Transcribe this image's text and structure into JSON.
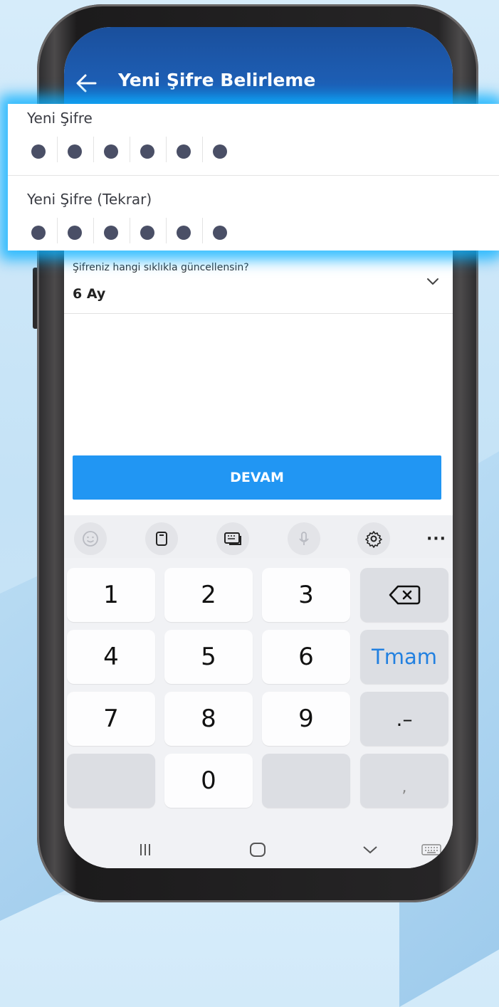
{
  "app_bar": {
    "title": "Yeni Şifre Belirleme",
    "back_icon": "arrow-left-icon"
  },
  "password_fields": [
    {
      "label": "Yeni Şifre",
      "masked_length": 6
    },
    {
      "label": "Yeni Şifre (Tekrar)",
      "masked_length": 6
    }
  ],
  "frequency": {
    "label": "Şifreniz hangi sıklıkla güncellensin?",
    "value": "6 Ay",
    "icon": "chevron-down-icon"
  },
  "continue_button": {
    "label": "DEVAM"
  },
  "keyboard": {
    "toolbar": [
      "emoji-icon",
      "clipboard-icon",
      "keyboard-layout-icon",
      "microphone-icon",
      "settings-icon"
    ],
    "more_label": "···",
    "keys": {
      "k1": "1",
      "k2": "2",
      "k3": "3",
      "k4": "4",
      "k5": "5",
      "k6": "6",
      "k7": "7",
      "k8": "8",
      "k9": "9",
      "k0": "0",
      "done": "Tmam",
      "dot_dash": ".–",
      "comma": ","
    },
    "backspace_icon": "backspace-icon"
  },
  "nav_bar": [
    "recent-apps-icon",
    "home-icon",
    "hide-keyboard-icon",
    "keyboard-switch-icon"
  ],
  "colors": {
    "app_bar": "#1f64bd",
    "button": "#2196f3",
    "done_key_text": "#2280e0",
    "glow": "#14b4ff",
    "dot": "#4a4f66"
  }
}
